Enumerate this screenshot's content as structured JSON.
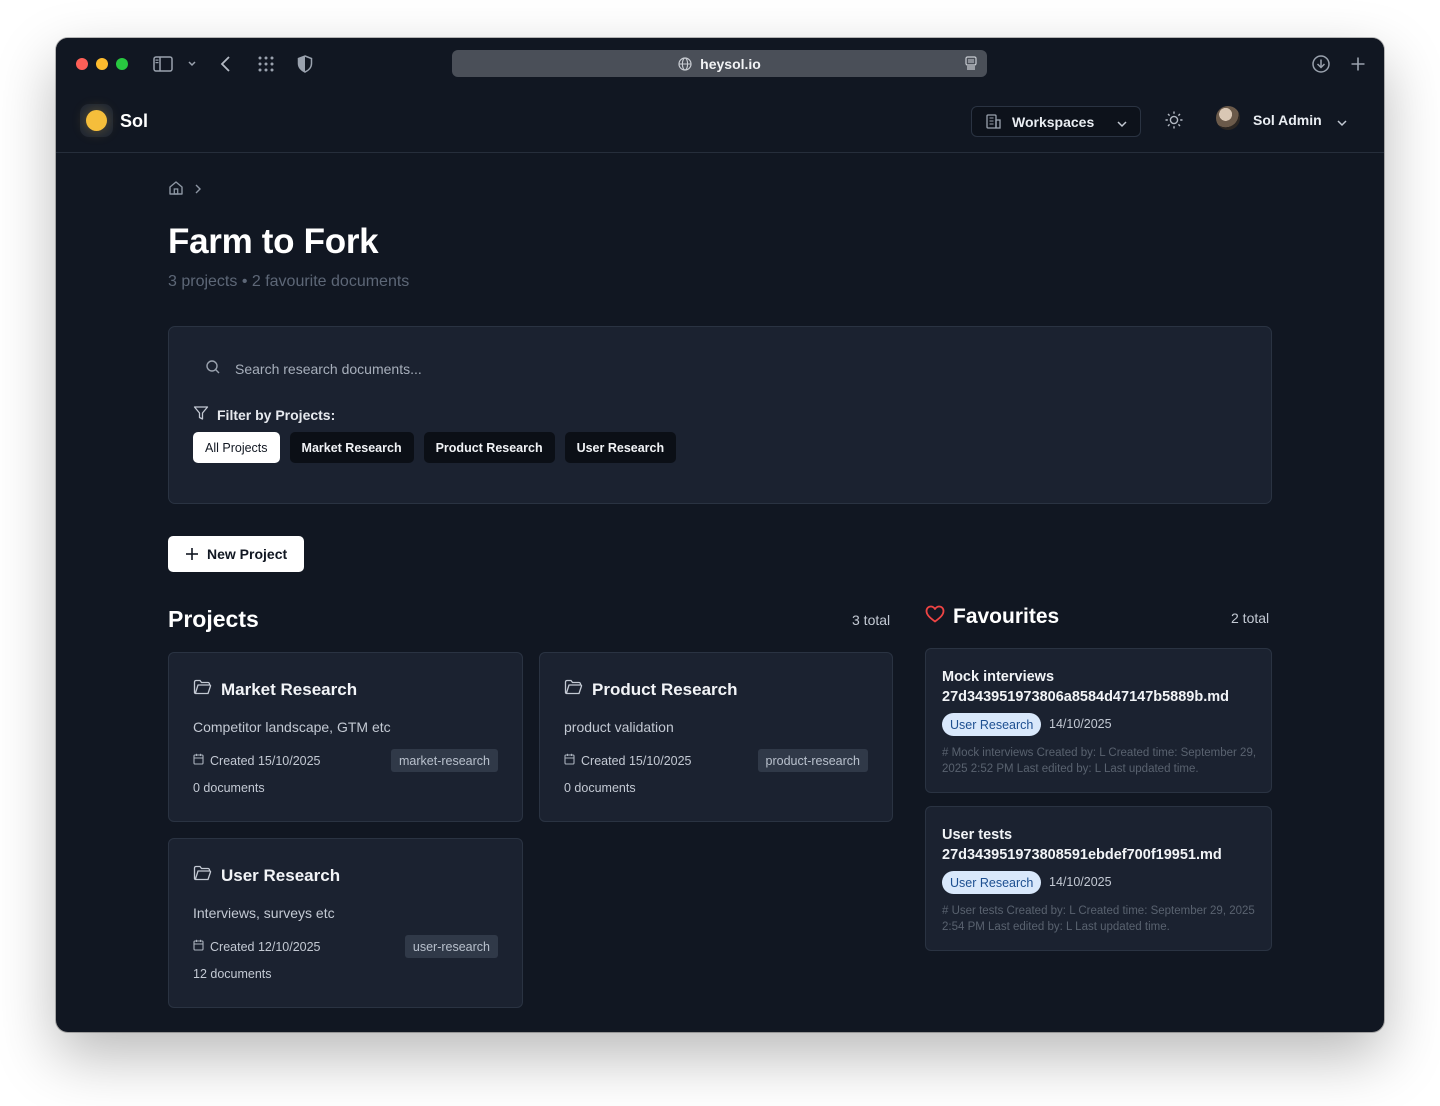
{
  "browser": {
    "url": "heysol.io"
  },
  "header": {
    "brand": "Sol",
    "workspaces_label": "Workspaces",
    "user_name": "Sol Admin"
  },
  "page": {
    "title": "Farm to Fork",
    "subtitle": "3 projects • 2 favourite documents"
  },
  "search": {
    "placeholder": "Search research documents..."
  },
  "filter": {
    "label": "Filter by Projects:",
    "chips": [
      "All Projects",
      "Market Research",
      "Product Research",
      "User Research"
    ],
    "active": "All Projects"
  },
  "new_project_label": "New Project",
  "projects": {
    "title": "Projects",
    "count": "3 total",
    "items": [
      {
        "name": "Market Research",
        "description": "Competitor landscape, GTM etc",
        "created": "Created 15/10/2025",
        "tag": "market-research",
        "documents": "0 documents"
      },
      {
        "name": "Product Research",
        "description": "product validation",
        "created": "Created 15/10/2025",
        "tag": "product-research",
        "documents": "0 documents"
      },
      {
        "name": "User Research",
        "description": "Interviews, surveys etc",
        "created": "Created 12/10/2025",
        "tag": "user-research",
        "documents": "12 documents"
      }
    ]
  },
  "favourites": {
    "title": "Favourites",
    "count": "2 total",
    "items": [
      {
        "title_line1": "Mock interviews",
        "title_line2": "27d343951973806a8584d47147b5889b.md",
        "badge": "User Research",
        "date": "14/10/2025",
        "snippet": "# Mock interviews Created by: L Created time: September 29, 2025 2:52 PM Last edited by: L Last updated time."
      },
      {
        "title_line1": "User tests",
        "title_line2": "27d343951973808591ebdef700f19951.md",
        "badge": "User Research",
        "date": "14/10/2025",
        "snippet": "# User tests Created by: L Created time: September 29, 2025 2:54 PM Last edited by: L Last updated time."
      }
    ]
  },
  "colors": {
    "background": "#111722",
    "card": "#1b2230",
    "accent_logo": "#f5be3b",
    "heart": "#ef4444",
    "badge_bg": "#d9e8fb",
    "badge_text": "#1d4f91"
  },
  "icons": [
    "sidebar-icon",
    "chevron-down-icon",
    "back-icon",
    "grid-icon",
    "shield-icon",
    "globe-icon",
    "reader-icon",
    "download-icon",
    "plus-icon",
    "building-icon",
    "sun-icon",
    "home-icon",
    "chevron-right-icon",
    "search-icon",
    "filter-icon",
    "folder-icon",
    "calendar-icon",
    "heart-icon"
  ]
}
